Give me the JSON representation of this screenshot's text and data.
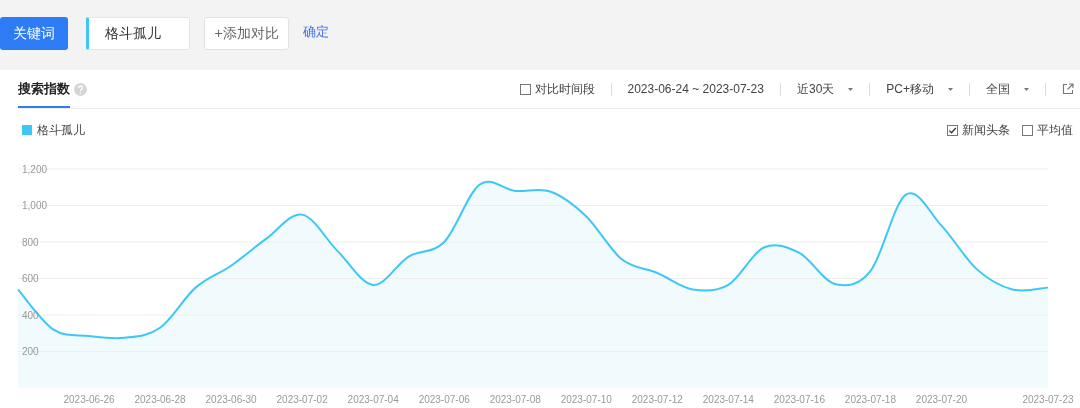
{
  "keyword_bar": {
    "type_button": "关键词",
    "keyword": "格斗孤儿",
    "add_button": "+添加对比",
    "confirm_link": "确定"
  },
  "tabs": [
    {
      "label": "搜索指数",
      "selected": true
    }
  ],
  "filters": {
    "compare_period": {
      "label": "对比时间段",
      "checked": false
    },
    "date_range": "2023-06-24 ~ 2023-07-23",
    "dropdowns": [
      {
        "label": "近30天"
      },
      {
        "label": "PC+移动"
      },
      {
        "label": "全国"
      }
    ]
  },
  "options": [
    {
      "label": "新闻头条",
      "checked": true
    },
    {
      "label": "平均值",
      "checked": false
    }
  ],
  "chart_data": {
    "type": "area",
    "grid": true,
    "categories": [
      null,
      null,
      "2023-06-26",
      null,
      "2023-06-28",
      null,
      "2023-06-30",
      null,
      "2023-07-02",
      null,
      "2023-07-04",
      null,
      "2023-07-06",
      null,
      "2023-07-08",
      null,
      "2023-07-10",
      null,
      "2023-07-12",
      null,
      "2023-07-14",
      null,
      "2023-07-16",
      null,
      "2023-07-18",
      null,
      "2023-07-20",
      null,
      null,
      "2023-07-23"
    ],
    "series": [
      {
        "name": "格斗孤儿",
        "color": "#3ec7f5",
        "values": [
          540,
          320,
          285,
          275,
          330,
          550,
          670,
          820,
          950,
          750,
          565,
          720,
          800,
          1115,
          1080,
          1075,
          940,
          705,
          630,
          540,
          565,
          770,
          740,
          570,
          640,
          1060,
          890,
          650,
          540,
          550
        ]
      }
    ],
    "ylim": [
      0,
      1200
    ],
    "yticks": [
      {
        "value": 200,
        "label": "200"
      },
      {
        "value": 400,
        "label": "400"
      },
      {
        "value": 600,
        "label": "600"
      },
      {
        "value": 800,
        "label": "800"
      },
      {
        "value": 1000,
        "label": "1,000"
      },
      {
        "value": 1200,
        "label": "1,200"
      }
    ]
  }
}
